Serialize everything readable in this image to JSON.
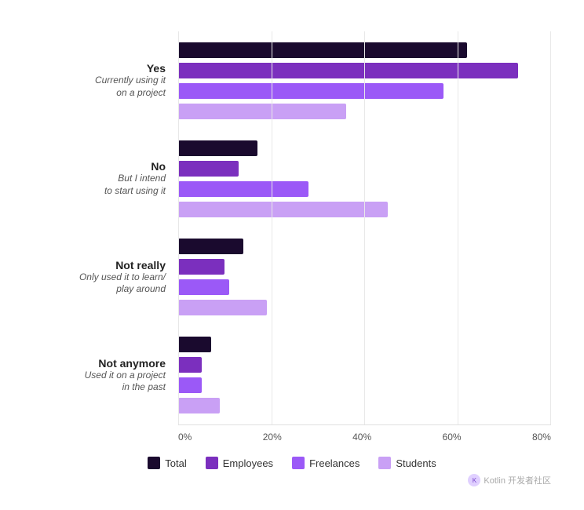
{
  "chart": {
    "groups": [
      {
        "id": "yes",
        "title": "Yes",
        "subtitle": "Currently using it\non a project",
        "bars": [
          {
            "id": "total",
            "color": "#1a0a2e",
            "value": 62
          },
          {
            "id": "employees",
            "color": "#7b2fbe",
            "value": 73
          },
          {
            "id": "freelances",
            "color": "#9b59f7",
            "value": 57
          },
          {
            "id": "students",
            "color": "#c9a0f5",
            "value": 36
          }
        ]
      },
      {
        "id": "no",
        "title": "No",
        "subtitle": "But I intend\nto start using it",
        "bars": [
          {
            "id": "total",
            "color": "#1a0a2e",
            "value": 17
          },
          {
            "id": "employees",
            "color": "#7b2fbe",
            "value": 13
          },
          {
            "id": "freelances",
            "color": "#9b59f7",
            "value": 28
          },
          {
            "id": "students",
            "color": "#c9a0f5",
            "value": 45
          }
        ]
      },
      {
        "id": "not-really",
        "title": "Not really",
        "subtitle": "Only used it to learn/\nplay around",
        "bars": [
          {
            "id": "total",
            "color": "#1a0a2e",
            "value": 14
          },
          {
            "id": "employees",
            "color": "#7b2fbe",
            "value": 10
          },
          {
            "id": "freelances",
            "color": "#9b59f7",
            "value": 11
          },
          {
            "id": "students",
            "color": "#c9a0f5",
            "value": 19
          }
        ]
      },
      {
        "id": "not-anymore",
        "title": "Not anymore",
        "subtitle": "Used it on a project\nin the past",
        "bars": [
          {
            "id": "total",
            "color": "#1a0a2e",
            "value": 7
          },
          {
            "id": "employees",
            "color": "#7b2fbe",
            "value": 5
          },
          {
            "id": "freelances",
            "color": "#9b59f7",
            "value": 5
          },
          {
            "id": "students",
            "color": "#c9a0f5",
            "value": 9
          }
        ]
      }
    ],
    "xAxis": {
      "labels": [
        "0%",
        "20%",
        "40%",
        "60%",
        "80%"
      ],
      "max": 80
    },
    "legend": [
      {
        "id": "total",
        "label": "Total",
        "color": "#1a0a2e"
      },
      {
        "id": "employees",
        "label": "Employees",
        "color": "#7b2fbe"
      },
      {
        "id": "freelances",
        "label": "Freelances",
        "color": "#9b59f7"
      },
      {
        "id": "students",
        "label": "Students",
        "color": "#c9a0f5"
      }
    ],
    "watermark": "Kotlin 开发者社区"
  }
}
